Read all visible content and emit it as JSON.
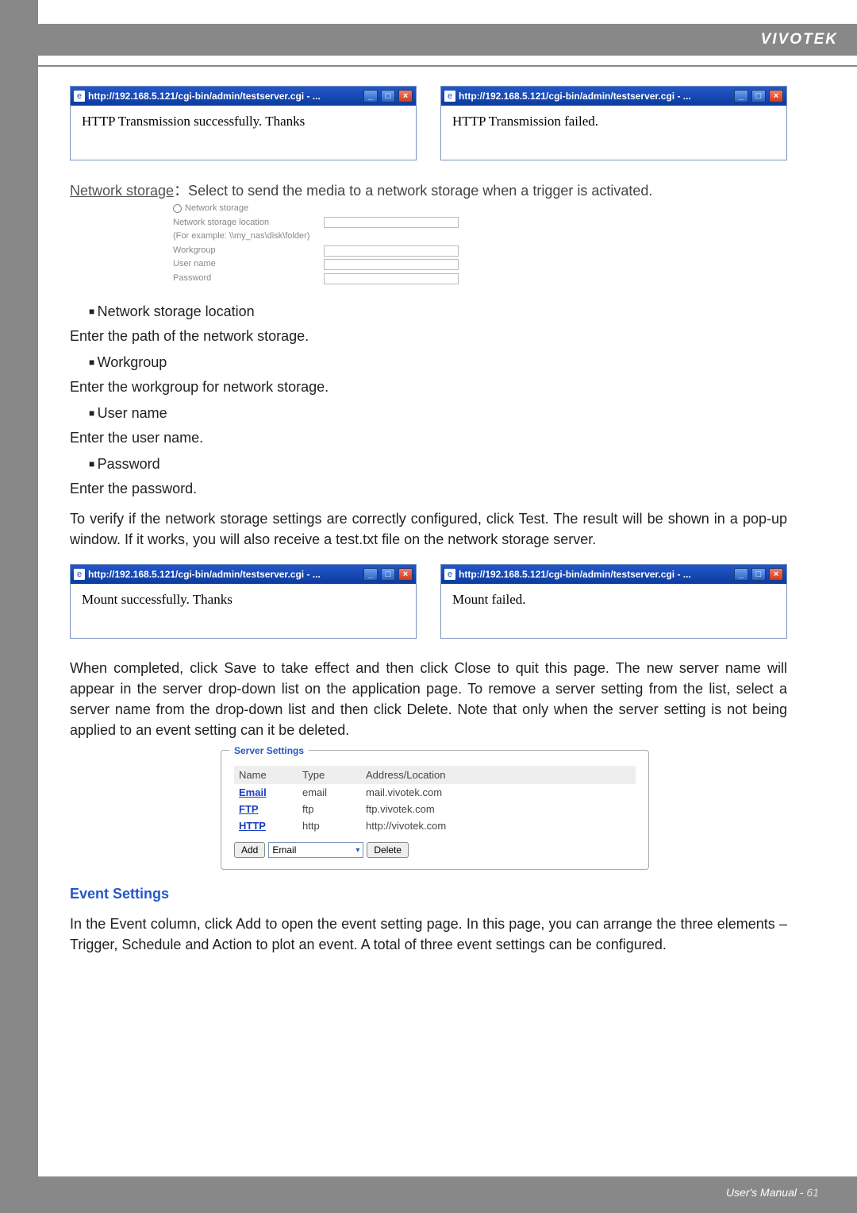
{
  "brand": "VIVOTEK",
  "popups": {
    "title": "http://192.168.5.121/cgi-bin/admin/testserver.cgi - ...",
    "s1": "HTTP Transmission successfully. Thanks",
    "s2": "HTTP Transmission failed.",
    "s3": "Mount successfully. Thanks",
    "s4": "Mount failed.",
    "min": "_",
    "max": "□",
    "close": "×"
  },
  "net": {
    "heading_u": "Network storage",
    "heading_rest": "：Select to send the media to a network storage when a trigger is activated.",
    "form": {
      "radio_label": "Network storage",
      "loc_label": "Network storage location",
      "loc_hint": "(For example: \\\\my_nas\\disk\\folder)",
      "workgroup": "Workgroup",
      "user": "User name",
      "pass": "Password"
    }
  },
  "doc": {
    "b1": "Network storage location",
    "p1": "Enter the path of the network storage.",
    "b2": "Workgroup",
    "p2": "Enter the workgroup for network storage.",
    "b3": "User name",
    "p3": "Enter the user name.",
    "b4": "Password",
    "p4": "Enter the password.",
    "verify": "To verify if the network storage settings are correctly configured, click Test. The result will be shown in a pop-up window. If it works, you will also receive a test.txt file on the network storage server.",
    "completed": "When completed, click Save to take effect and then click Close to quit this page. The new server name will appear in the server drop-down list on the application page. To remove a server setting from the list, select a server name from the drop-down list and then click Delete. Note that only when the server setting is not being applied to an event setting can it be deleted."
  },
  "server": {
    "legend": "Server Settings",
    "cols": {
      "name": "Name",
      "type": "Type",
      "addr": "Address/Location"
    },
    "rows": [
      {
        "name": "Email",
        "type": "email",
        "addr": "mail.vivotek.com"
      },
      {
        "name": "FTP",
        "type": "ftp",
        "addr": "ftp.vivotek.com"
      },
      {
        "name": "HTTP",
        "type": "http",
        "addr": "http://vivotek.com"
      }
    ],
    "add": "Add",
    "select": "Email",
    "delete": "Delete"
  },
  "event": {
    "heading": "Event Settings",
    "para": "In the Event column, click Add to open the event setting page. In this page, you can arrange the three elements – Trigger, Schedule and Action to plot an event. A total of three event settings can be configured."
  },
  "footer": {
    "um": "User's Manual - ",
    "page": "61"
  }
}
